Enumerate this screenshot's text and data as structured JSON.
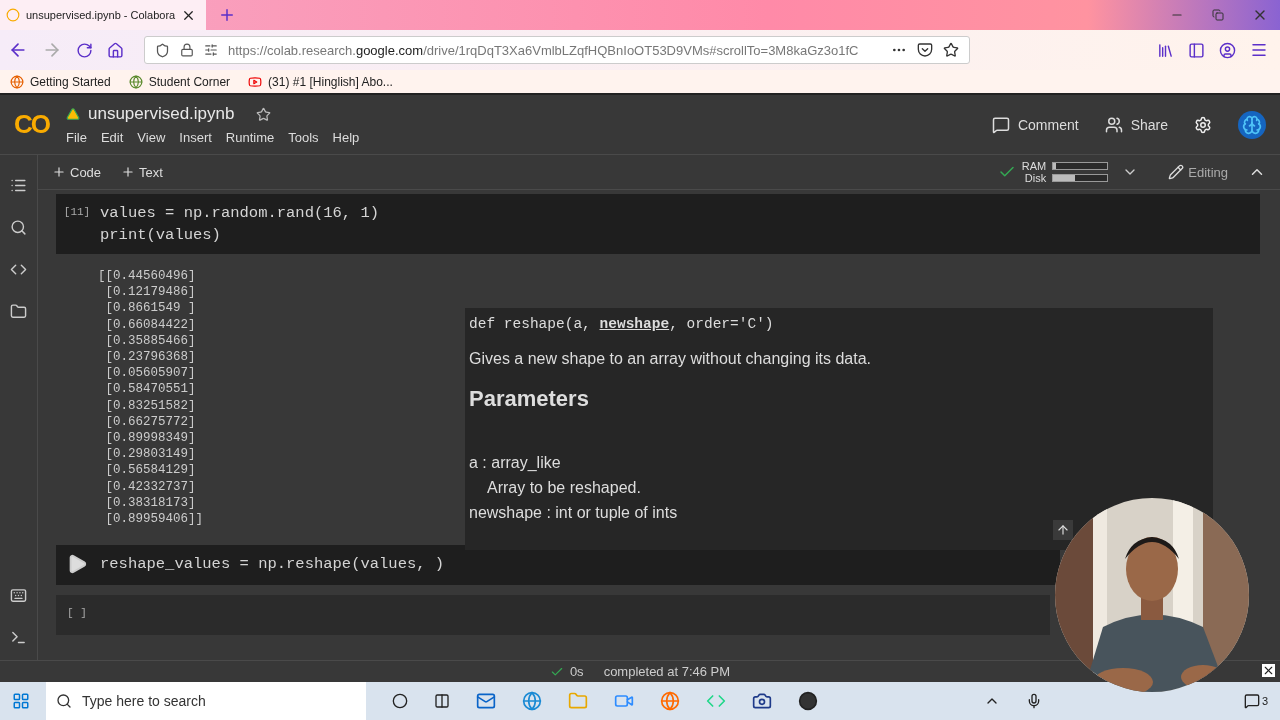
{
  "browser": {
    "tab": {
      "title": "unsupervised.ipynb - Colabora"
    },
    "url_host": "https://colab.research.",
    "url_domain": "google.com",
    "url_path": "/drive/1rqDqT3Xa6VmlbLZqfHQBnIoOT53D9VMs#scrollTo=3M8kaGz3o1fC",
    "bookmarks": [
      {
        "label": "Getting Started"
      },
      {
        "label": "Student Corner"
      },
      {
        "label": "(31) #1 [Hinglish] Abo..."
      }
    ]
  },
  "notebook": {
    "title": "unsupervised.ipynb",
    "logo": "CO",
    "menu": [
      "File",
      "Edit",
      "View",
      "Insert",
      "Runtime",
      "Tools",
      "Help"
    ],
    "actions": [
      "Comment",
      "Share"
    ]
  },
  "toolbar": {
    "add": [
      "Code",
      "Text"
    ],
    "resources": [
      {
        "label": "RAM",
        "level": 0.05
      },
      {
        "label": "Disk",
        "level": 0.4
      }
    ],
    "mode": "Editing"
  },
  "cells": [
    {
      "kind": "code",
      "counter": "[11]",
      "lines": [
        "values = np.random.rand(16, 1)",
        "print(values)"
      ],
      "output": [
        "[[0.44560496]",
        " [0.12179486]",
        " [0.8661549 ]",
        " [0.66084422]",
        " [0.35885466]",
        " [0.23796368]",
        " [0.05605907]",
        " [0.58470551]",
        " [0.83251582]",
        " [0.66275772]",
        " [0.89998349]",
        " [0.29803149]",
        " [0.56584129]",
        " [0.42332737]",
        " [0.38318173]",
        " [0.89959406]]"
      ]
    },
    {
      "kind": "editing",
      "lines": [
        "reshape_values = np.reshape(values, )"
      ]
    },
    {
      "kind": "empty",
      "counter": "[ ]"
    }
  ],
  "tooltip": {
    "signature": "def reshape(a, **newshape**, order='C')",
    "description": "Gives a new shape to an array without changing its data.",
    "heading": "Parameters",
    "params": [
      {
        "name": "a : array_like",
        "description": "Array to be reshaped."
      },
      {
        "name": "newshape : int or tuple of ints"
      }
    ]
  },
  "status": {
    "duration": "0s",
    "message": "completed at 7:46 PM"
  },
  "taskbar": {
    "search_placeholder": "Type here to search",
    "notifications": "3"
  }
}
